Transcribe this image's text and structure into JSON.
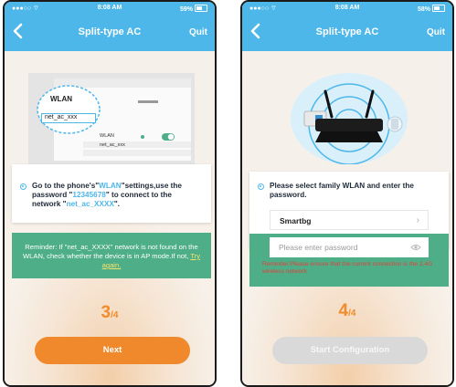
{
  "left": {
    "status": {
      "time": "8:08 AM",
      "battery": "59%"
    },
    "header": {
      "title": "Split-type AC",
      "quit": "Quit"
    },
    "illustration": {
      "wlan_label": "WLAN",
      "network_label": "net_ac_xxx",
      "row_wlan": "WLAN",
      "row_network": "net_ac_xxx"
    },
    "instruction": {
      "part1": "Go to the phone's\"",
      "wlan": "WLAN",
      "part2": "\"settings,use the password \"",
      "password": "12345678",
      "part3": "\" to connect to the network \"",
      "network": "net_ac_XXXX",
      "part4": "\"."
    },
    "reminder": {
      "text": "Reminder: If \"net_ac_XXXX\" network is not found on the WLAN, check whether the device is in AP mode.If not,",
      "link": "Try again."
    },
    "step": {
      "current": "3",
      "total": "4"
    },
    "button": {
      "label": "Next",
      "color": "#f0892c"
    }
  },
  "right": {
    "status": {
      "time": "8:08 AM",
      "battery": "58%"
    },
    "header": {
      "title": "Split-type AC",
      "quit": "Quit"
    },
    "instruction": "Please select family WLAN and enter the password.",
    "wlan_name": "Smartbg",
    "password_placeholder": "Please enter password",
    "reminder": "Reminder:Please ensure that the current connection is the 2.4G wireless network",
    "step": {
      "current": "4",
      "total": "4"
    },
    "button": {
      "label": "Start Configuration",
      "color": "#d9d9d9"
    }
  },
  "colors": {
    "header": "#4db7ea",
    "reminder": "#4dae88",
    "accent": "#f28b2c"
  }
}
